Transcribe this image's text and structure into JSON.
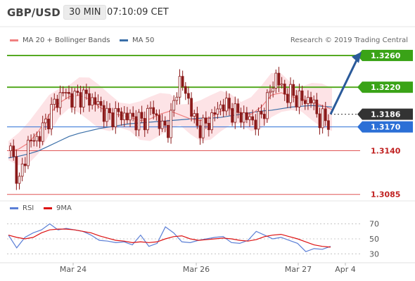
{
  "header": {
    "pair": "GBP/USD",
    "timeframe": "30 MIN",
    "time": "07:10:09 CET"
  },
  "legend": {
    "bollinger": "MA 20 + Bollinger Bands",
    "ma50": "MA 50",
    "rsi": "RSI",
    "rsi_ma": "9MA",
    "credit": "Research © 2019 Trading Central"
  },
  "colors": {
    "candle": "#8b1a1a",
    "ma20": "#f08080",
    "band_fill": "#fde0e3",
    "ma50": "#3a6fa8",
    "target": "#3aa317",
    "resistance_line": "#55aa22",
    "support_line": "#e05555",
    "pivot": "#333333",
    "current": "#2b6fd6",
    "arrow": "#2a5a9a",
    "rsi": "#5b7fd6",
    "rsi_ma": "#dd1111"
  },
  "levels": [
    {
      "value": "1.3260",
      "kind": "target"
    },
    {
      "value": "1.3220",
      "kind": "resistance"
    },
    {
      "value": "1.3186",
      "kind": "pivot"
    },
    {
      "value": "1.3170",
      "kind": "current"
    },
    {
      "value": "1.3140",
      "kind": "support"
    },
    {
      "value": "1.3085",
      "kind": "support"
    }
  ],
  "x_labels": [
    "Mar 24",
    "Mar 26",
    "Mar 27",
    "Apr 4"
  ],
  "rsi_ticks": [
    "70",
    "50",
    "30"
  ],
  "chart_data": [
    {
      "type": "line",
      "title": "GBP/USD 30 MIN",
      "ylim": [
        1.3075,
        1.3275
      ],
      "x_ticks": [
        "Mar 24",
        "Mar 26",
        "Mar 27",
        "Apr 4"
      ],
      "series": [
        {
          "name": "MA 50",
          "values": [
            1.3131,
            1.3133,
            1.3136,
            1.314,
            1.3146,
            1.3152,
            1.3158,
            1.3162,
            1.3165,
            1.3168,
            1.317,
            1.3172,
            1.3174,
            1.3175,
            1.3176,
            1.3177,
            1.3178,
            1.3179,
            1.318,
            1.3181,
            1.3181,
            1.3182,
            1.3184,
            1.3186,
            1.3188,
            1.319,
            1.3191,
            1.3193,
            1.3195,
            1.3196,
            1.3197,
            1.3196,
            1.3195
          ]
        },
        {
          "name": "MA 20 + Bollinger Bands",
          "values": [
            1.314,
            1.3142,
            1.315,
            1.3165,
            1.3185,
            1.32,
            1.3208,
            1.321,
            1.3205,
            1.3195,
            1.3188,
            1.3185,
            1.3182,
            1.3178,
            1.318,
            1.3186,
            1.319,
            1.3185,
            1.318,
            1.3178,
            1.3182,
            1.319,
            1.3192,
            1.3188,
            1.3186,
            1.3195,
            1.321,
            1.3213,
            1.3208,
            1.3205,
            1.3202,
            1.3197,
            1.3192
          ]
        }
      ],
      "price_path": [
        1.314,
        1.31,
        1.315,
        1.3155,
        1.3175,
        1.32,
        1.3215,
        1.3205,
        1.321,
        1.3205,
        1.3198,
        1.3182,
        1.3186,
        1.3184,
        1.318,
        1.3176,
        1.3195,
        1.317,
        1.317,
        1.323,
        1.321,
        1.317,
        1.317,
        1.3185,
        1.32,
        1.319,
        1.3185,
        1.318,
        1.3176,
        1.32,
        1.3235,
        1.3212,
        1.321,
        1.3203,
        1.3205,
        1.318,
        1.3178
      ]
    },
    {
      "type": "line",
      "title": "RSI",
      "ylim": [
        20,
        80
      ],
      "y_ticks": [
        70,
        50,
        30
      ],
      "series": [
        {
          "name": "RSI",
          "values": [
            55,
            38,
            52,
            58,
            62,
            70,
            62,
            64,
            62,
            60,
            55,
            48,
            47,
            45,
            46,
            42,
            55,
            40,
            44,
            66,
            58,
            46,
            45,
            48,
            50,
            52,
            53,
            45,
            44,
            48,
            60,
            55,
            50,
            52,
            48,
            44,
            33,
            37,
            36,
            40
          ]
        },
        {
          "name": "9MA",
          "values": [
            55,
            52,
            50,
            52,
            58,
            62,
            63,
            63,
            62,
            60,
            58,
            54,
            51,
            48,
            47,
            45,
            46,
            45,
            46,
            50,
            53,
            54,
            50,
            48,
            49,
            50,
            51,
            50,
            48,
            47,
            49,
            53,
            55,
            56,
            53,
            50,
            46,
            42,
            40,
            39
          ]
        }
      ]
    }
  ]
}
